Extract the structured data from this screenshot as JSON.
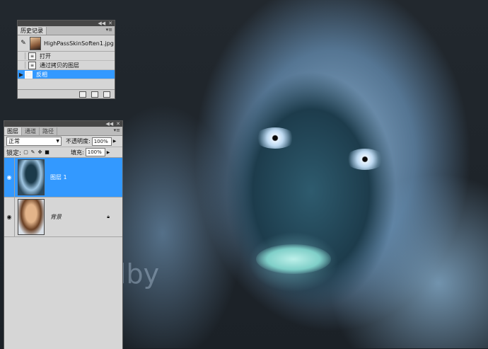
{
  "history_panel": {
    "tab": "历史记录",
    "snapshot_name": "HighPassSkinSoften1.jpg",
    "steps": [
      {
        "label": "打开",
        "selected": false
      },
      {
        "label": "通过拷贝的图层",
        "selected": false
      },
      {
        "label": "反相",
        "selected": true
      }
    ]
  },
  "layers_panel": {
    "tabs": [
      "图层",
      "通道",
      "路径"
    ],
    "blend_mode": "正常",
    "opacity_label": "不透明度:",
    "opacity_value": "100%",
    "lock_label": "锁定:",
    "fill_label": "填充:",
    "fill_value": "100%",
    "layers": [
      {
        "name": "图层 1",
        "selected": true
      },
      {
        "name": "背景",
        "selected": false,
        "locked": true
      }
    ]
  },
  "canvas": {
    "watermark": "lby"
  },
  "colors": {
    "selection": "#3399ff",
    "panel_bg": "#d6d6d6",
    "panel_header": "#464646"
  }
}
